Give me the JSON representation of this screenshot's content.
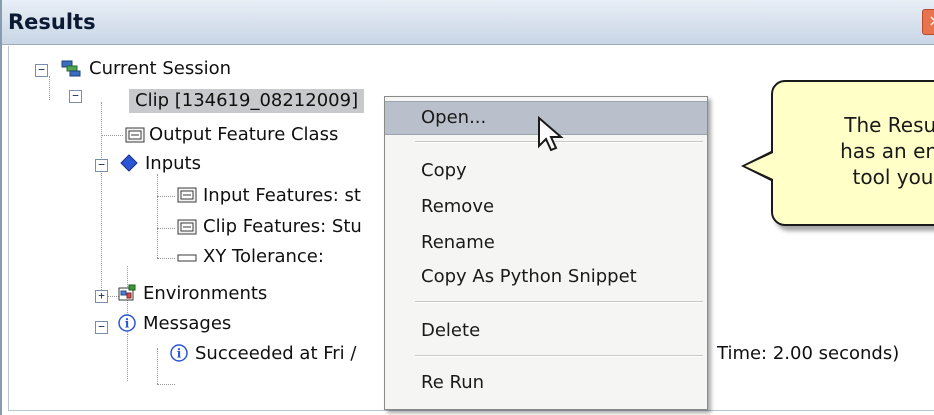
{
  "window": {
    "title": "Results",
    "close_glyph": "×"
  },
  "tree": {
    "session": "Current Session",
    "clip": "Clip [134619_08212009]",
    "output": "Output Feature Class",
    "inputs": "Inputs",
    "input_features": "Input Features: st",
    "clip_features": "Clip Features: Stu",
    "xy_tolerance": "XY Tolerance:",
    "environments": "Environments",
    "messages": "Messages",
    "succeeded_left": "Succeeded at Fri /",
    "succeeded_right": "Time: 2.00 seconds)"
  },
  "context_menu": {
    "open": "Open...",
    "copy": "Copy",
    "remove": "Remove",
    "rename": "Rename",
    "copy_python": "Copy As Python Snippet",
    "delete": "Delete",
    "rerun": "Re Run"
  },
  "callout": {
    "line1": "The Resul",
    "line2": "has an ent",
    "line3": "tool you"
  },
  "icons": {
    "session": "session-tree-icon",
    "feature": "feature-class-icon",
    "inputs": "diamond-icon",
    "tolerance": "field-icon",
    "environments": "environments-icon",
    "messages": "info-icon",
    "cursor": "mouse-pointer-icon"
  },
  "colors": {
    "selection": "#c7c9cc",
    "menu_hover": "#b9c0cb",
    "callout_bg": "#ffffc8",
    "diamond": "#2a56d6"
  }
}
